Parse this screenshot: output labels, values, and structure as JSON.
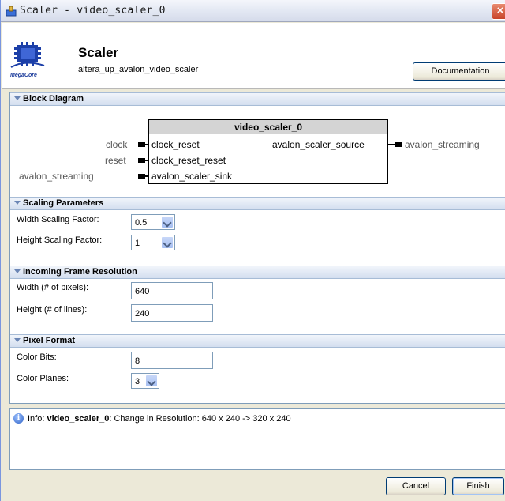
{
  "window": {
    "title": "Scaler - video_scaler_0",
    "close_glyph": "×"
  },
  "header": {
    "title": "Scaler",
    "subtitle": "altera_up_avalon_video_scaler",
    "logo_text": "MegaCore",
    "documentation_label": "Documentation"
  },
  "block_diagram": {
    "section_label": "Block Diagram",
    "component_name": "video_scaler_0",
    "ports": {
      "clock_external": "clock",
      "clock_internal": "clock_reset",
      "reset_external": "reset",
      "reset_internal": "clock_reset_reset",
      "sink_external": "avalon_streaming",
      "sink_internal": "avalon_scaler_sink",
      "source_internal": "avalon_scaler_source",
      "source_external": "avalon_streaming"
    }
  },
  "scaling": {
    "section_label": "Scaling Parameters",
    "width_label": "Width Scaling Factor:",
    "width_value": "0.5",
    "height_label": "Height Scaling Factor:",
    "height_value": "1"
  },
  "resolution": {
    "section_label": "Incoming Frame Resolution",
    "width_label": "Width (# of pixels):",
    "width_value": "640",
    "height_label": "Height (# of lines):",
    "height_value": "240"
  },
  "pixel_format": {
    "section_label": "Pixel Format",
    "color_bits_label": "Color Bits:",
    "color_bits_value": "8",
    "color_planes_label": "Color Planes:",
    "color_planes_value": "3"
  },
  "info": {
    "prefix": "Info: ",
    "component": "video_scaler_0",
    "message": ": Change in Resolution: 640 x 240 -> 320 x 240"
  },
  "footer": {
    "cancel_label": "Cancel",
    "finish_label": "Finish"
  },
  "colors": {
    "section_header": "#d3deef",
    "title_bar": "#e3e8f3",
    "close_button": "#c8442a"
  }
}
